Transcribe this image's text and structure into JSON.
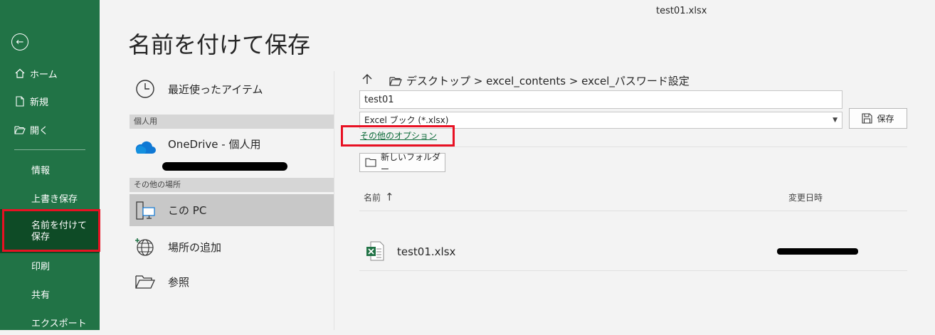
{
  "window": {
    "file_title": "test01.xlsx"
  },
  "sidebar": {
    "back_icon": "back-arrow-icon",
    "items": [
      {
        "label": "ホーム",
        "icon": "home-icon"
      },
      {
        "label": "新規",
        "icon": "new-document-icon"
      },
      {
        "label": "開く",
        "icon": "open-folder-icon"
      },
      {
        "label": "情報"
      },
      {
        "label": "上書き保存"
      },
      {
        "label": "名前を付けて保存",
        "active": true
      },
      {
        "label": "印刷"
      },
      {
        "label": "共有"
      },
      {
        "label": "エクスポート"
      }
    ]
  },
  "page": {
    "title": "名前を付けて保存"
  },
  "places": {
    "recent_label": "最近使ったアイテム",
    "personal_header": "個人用",
    "onedrive_label": "OneDrive - 個人用",
    "other_header": "その他の場所",
    "this_pc_label": "この PC",
    "add_place_label": "場所の追加",
    "browse_label": "参照"
  },
  "save_panel": {
    "breadcrumb": "デスクトップ > excel_contents > excel_パスワード設定",
    "filename_value": "test01",
    "filetype_value": "Excel ブック (*.xlsx)",
    "save_label": "保存",
    "more_options_label": "その他のオプション",
    "new_folder_label": "新しいフォルダー",
    "col_name": "名前",
    "col_modified": "変更日時",
    "files": [
      {
        "name": "test01.xlsx",
        "icon": "excel-file-icon"
      }
    ]
  },
  "colors": {
    "sidebar_bg": "#217346",
    "sidebar_active": "#0e4b26",
    "highlight_red": "#e81123",
    "link_green": "#0e6b3a"
  }
}
